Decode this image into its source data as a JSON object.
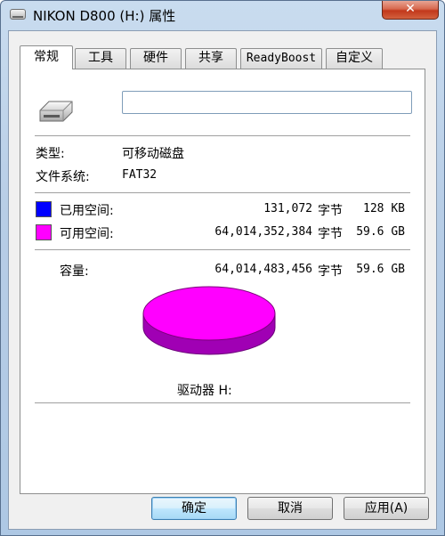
{
  "window": {
    "title": "NIKON D800 (H:) 属性",
    "close_label": "✕"
  },
  "tabs": [
    {
      "label": "常规",
      "active": true
    },
    {
      "label": "工具"
    },
    {
      "label": "硬件"
    },
    {
      "label": "共享"
    },
    {
      "label": "ReadyBoost"
    },
    {
      "label": "自定义"
    }
  ],
  "general": {
    "volume_name_value": "",
    "type_label": "类型:",
    "type_value": "可移动磁盘",
    "fs_label": "文件系统:",
    "fs_value": "FAT32",
    "used": {
      "label": "已用空间:",
      "bytes": "131,072",
      "unit": "字节",
      "size": "128 KB",
      "color": "#0000ff"
    },
    "free": {
      "label": "可用空间:",
      "bytes": "64,014,352,384",
      "unit": "字节",
      "size": "59.6 GB",
      "color": "#ff00ff"
    },
    "capacity": {
      "label": "容量:",
      "bytes": "64,014,483,456",
      "unit": "字节",
      "size": "59.6 GB"
    },
    "drive_label": "驱动器 H:"
  },
  "buttons": {
    "ok": "确定",
    "cancel": "取消",
    "apply": "应用(A)"
  }
}
